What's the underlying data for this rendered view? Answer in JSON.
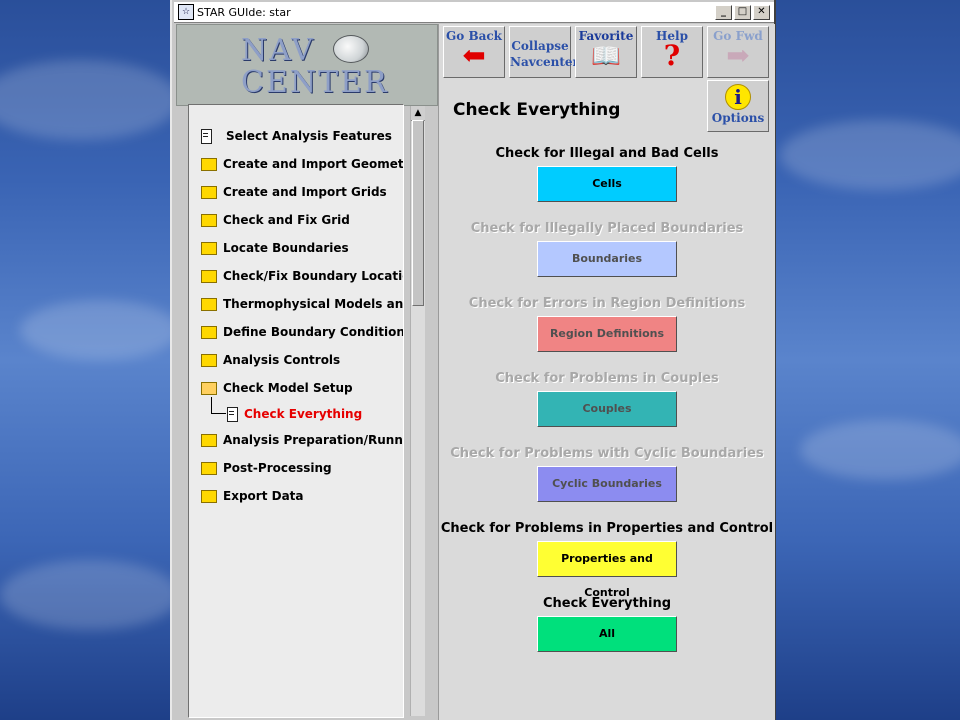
{
  "window": {
    "title": "STAR GUIde: star",
    "minimize": "_",
    "maximize": "□",
    "close": "✕"
  },
  "logo": {
    "line1": "NAV",
    "line2": "CENTER"
  },
  "tree": [
    {
      "label": "Select Analysis Features",
      "icon": "document-icon",
      "state": "normal"
    },
    {
      "label": "Create and Import Geometry",
      "icon": "folder-icon",
      "state": "normal"
    },
    {
      "label": "Create and Import Grids",
      "icon": "folder-icon",
      "state": "normal"
    },
    {
      "label": "Check and Fix Grid",
      "icon": "folder-icon",
      "state": "normal"
    },
    {
      "label": "Locate Boundaries",
      "icon": "folder-icon",
      "state": "normal"
    },
    {
      "label": "Check/Fix Boundary Locations",
      "icon": "folder-icon",
      "state": "normal"
    },
    {
      "label": "Thermophysical Models and P",
      "icon": "folder-icon",
      "state": "normal"
    },
    {
      "label": "Define Boundary Conditions",
      "icon": "folder-icon",
      "state": "normal"
    },
    {
      "label": "Analysis Controls",
      "icon": "folder-icon",
      "state": "normal"
    },
    {
      "label": "Check Model Setup",
      "icon": "open-folder-icon",
      "state": "expanded"
    },
    {
      "label": "Check Everything",
      "icon": "document-icon",
      "state": "active"
    },
    {
      "label": "Analysis Preparation/Running",
      "icon": "folder-icon",
      "state": "normal"
    },
    {
      "label": "Post-Processing",
      "icon": "folder-icon",
      "state": "normal"
    },
    {
      "label": "Export Data",
      "icon": "folder-icon",
      "state": "normal"
    }
  ],
  "toolbar": {
    "go_back": "Go Back",
    "collapse_1": "Collapse",
    "collapse_2": "Navcenter",
    "favorite": "Favorite",
    "help": "Help",
    "go_fwd": "Go Fwd",
    "options": "Options"
  },
  "heading": "Check Everything",
  "checks": [
    {
      "title": "Check for Illegal and Bad Cells",
      "button": "Cells",
      "color": "#00ccff",
      "enabled": true
    },
    {
      "title": "Check for Illegally Placed Boundaries",
      "button": "Boundaries",
      "color": "#b4c8ff",
      "enabled": false
    },
    {
      "title": "Check for Errors in Region Definitions",
      "button": "Region Definitions",
      "color": "#f08484",
      "enabled": false
    },
    {
      "title": "Check for Problems in Couples",
      "button": "Couples",
      "color": "#33b4b4",
      "enabled": false
    },
    {
      "title": "Check for Problems with Cyclic Boundaries",
      "button": "Cyclic Boundaries",
      "color": "#8c8cf0",
      "enabled": false
    },
    {
      "title": "Check for Problems in Properties and Control",
      "button": "Properties and Control",
      "color": "#ffff33",
      "enabled": true
    },
    {
      "title": "Check Everything",
      "button": "All",
      "color": "#00e07c",
      "enabled": true
    }
  ]
}
